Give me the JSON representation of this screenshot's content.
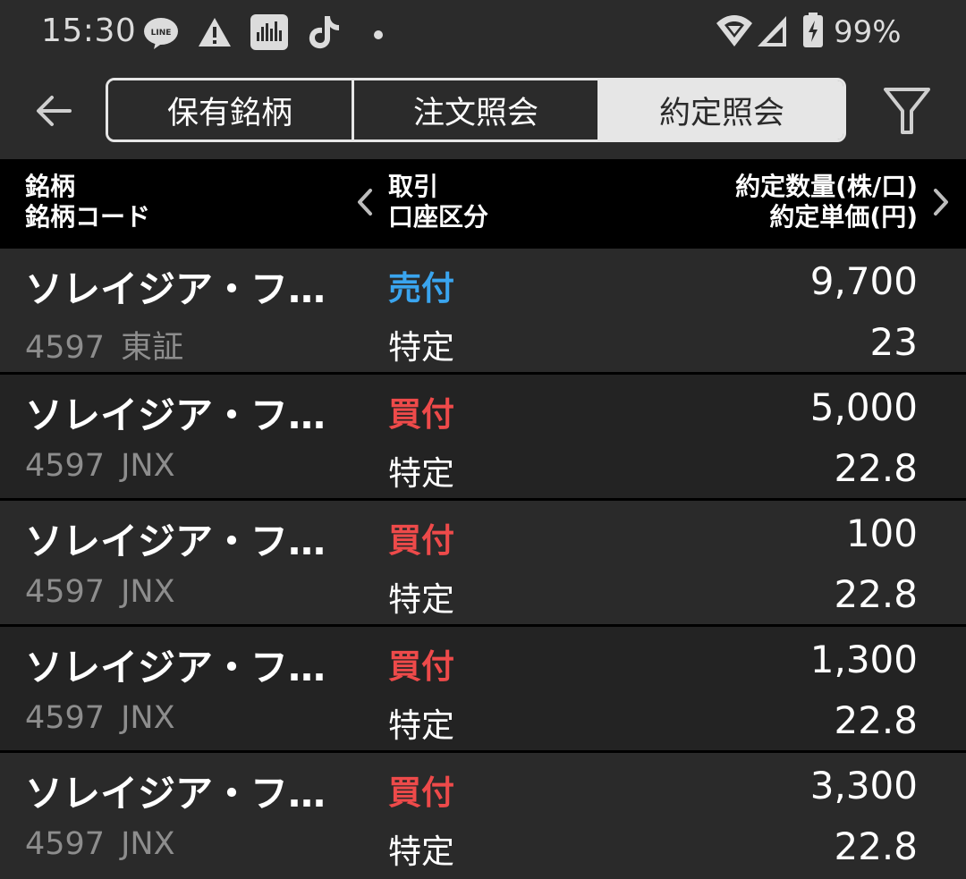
{
  "status_bar": {
    "time": "15:30",
    "battery": "99%",
    "icons": [
      "line-icon",
      "warning-icon",
      "sound-wave-icon",
      "tiktok-icon",
      "dot-icon",
      "wifi-icon",
      "signal-icon",
      "battery-charging-icon"
    ]
  },
  "header": {
    "tabs": [
      {
        "label": "保有銘柄",
        "active": false
      },
      {
        "label": "注文照会",
        "active": false
      },
      {
        "label": "約定照会",
        "active": true
      }
    ],
    "back_icon": "back-arrow-icon",
    "filter_icon": "filter-icon"
  },
  "columns": {
    "left_line1": "銘柄",
    "left_line2": "銘柄コード",
    "mid_line1": "取引",
    "mid_line2": "口座区分",
    "right_line1": "約定数量(株/口)",
    "right_line2": "約定単価(円)"
  },
  "rows": [
    {
      "name": "ソレイジア・フ…",
      "code": "4597",
      "market": "東証",
      "trade": "売付",
      "side": "sell",
      "account": "特定",
      "quantity": "9,700",
      "price": "23"
    },
    {
      "name": "ソレイジア・フ…",
      "code": "4597",
      "market": "JNX",
      "trade": "買付",
      "side": "buy",
      "account": "特定",
      "quantity": "5,000",
      "price": "22.8"
    },
    {
      "name": "ソレイジア・フ…",
      "code": "4597",
      "market": "JNX",
      "trade": "買付",
      "side": "buy",
      "account": "特定",
      "quantity": "100",
      "price": "22.8"
    },
    {
      "name": "ソレイジア・フ…",
      "code": "4597",
      "market": "JNX",
      "trade": "買付",
      "side": "buy",
      "account": "特定",
      "quantity": "1,300",
      "price": "22.8"
    },
    {
      "name": "ソレイジア・フ…",
      "code": "4597",
      "market": "JNX",
      "trade": "買付",
      "side": "buy",
      "account": "特定",
      "quantity": "3,300",
      "price": "22.8"
    }
  ],
  "colors": {
    "sell": "#3aa5ef",
    "buy": "#ee4a4a",
    "background": "#2a2a2a",
    "header_bar": "#000000"
  }
}
